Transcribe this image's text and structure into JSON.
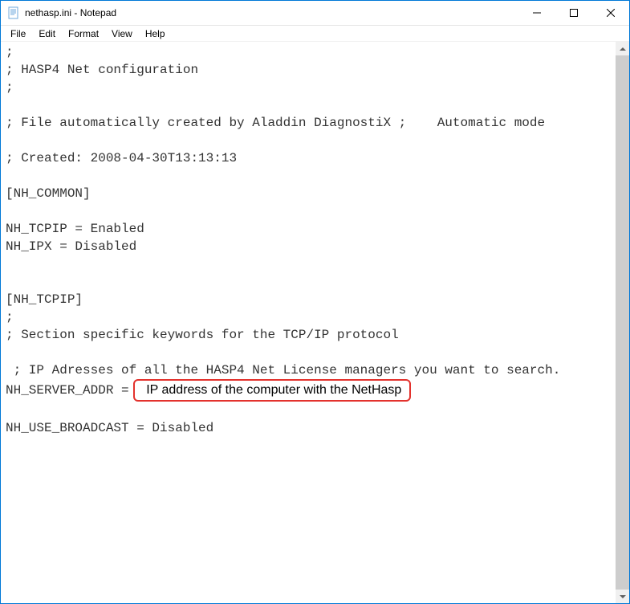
{
  "window": {
    "title": "nethasp.ini - Notepad"
  },
  "menu": {
    "items": [
      "File",
      "Edit",
      "Format",
      "View",
      "Help"
    ]
  },
  "content": {
    "lines": [
      ";",
      "; HASP4 Net configuration",
      ";",
      "",
      "; File automatically created by Aladdin DiagnostiX ;    Automatic mode",
      "",
      "; Created: 2008-04-30T13:13:13",
      "",
      "[NH_COMMON]",
      "",
      "NH_TCPIP = Enabled",
      "NH_IPX = Disabled",
      "",
      "",
      "[NH_TCPIP]",
      ";",
      "; Section specific keywords for the TCP/IP protocol",
      "",
      " ; IP Adresses of all the HASP4 Net License managers you want to search."
    ],
    "server_addr_prefix": "NH_SERVER_ADDR = ",
    "annotation_text": "IP address of the computer with the NetHasp",
    "lines_after": [
      "",
      "NH_USE_BROADCAST = Disabled",
      ""
    ]
  }
}
